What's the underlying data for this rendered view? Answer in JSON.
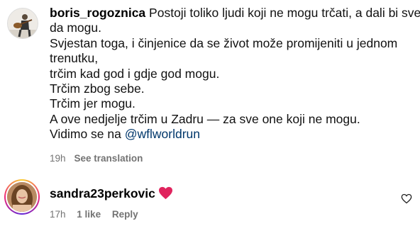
{
  "comments": [
    {
      "username": "boris_rogoznica",
      "lines": [
        "Postoji toliko ljudi koji ne mogu trčati, a dali bi sve",
        "da mogu.",
        "Svjestan toga, i činjenice da se život može promijeniti u jednom",
        "trenutku,",
        "trčim kad god i gdje god mogu.",
        "Trčim zbog sebe.",
        "Trčim jer mogu.",
        "A ove nedjelje trčim u Zadru — za sve one koji ne mogu.",
        "Vidimo se na"
      ],
      "mention": "@wflworldrun",
      "time": "19h",
      "see_translation": "See translation"
    },
    {
      "username": "sandra23perkovic",
      "emoji": "heart-emoji",
      "time": "17h",
      "likes": "1 like",
      "reply": "Reply"
    }
  ],
  "icons": {
    "like": "heart-outline-icon"
  },
  "colors": {
    "meta": "#737373",
    "mention": "#00376b",
    "heart": "#e0245e"
  }
}
